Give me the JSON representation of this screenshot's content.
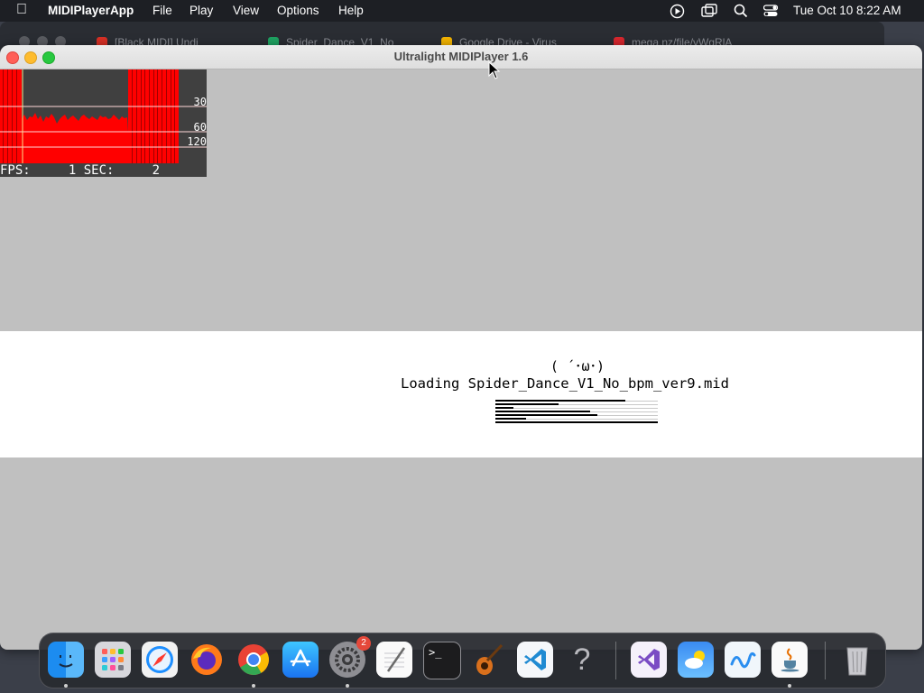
{
  "menubar": {
    "app_name": "MIDIPlayerApp",
    "menus": [
      "File",
      "Play",
      "View",
      "Options",
      "Help"
    ],
    "clock": "Tue Oct 10  8:22 AM"
  },
  "background_window": {
    "tabs": [
      {
        "label": "[Black MIDI] Undi",
        "color": "#d93025"
      },
      {
        "label": "Spider_Dance_V1_No",
        "color": "#1ea362"
      },
      {
        "label": "Google Drive - Virus",
        "color": "#f4b400"
      },
      {
        "label": "mega.nz/file/yWgRlA",
        "color": "#d9272e"
      }
    ]
  },
  "window": {
    "title": "Ultralight MIDIPlayer 1.6"
  },
  "fps_overlay": {
    "scale_labels": [
      "30",
      "60",
      "120"
    ],
    "stats_line": "FPS:     1 SEC:     2"
  },
  "loading": {
    "face": "( ´･ω･)",
    "text": "Loading Spider_Dance_V1_No_bpm_ver9.mid"
  },
  "dock": {
    "items": [
      {
        "name": "finder-icon",
        "running": true
      },
      {
        "name": "launchpad-icon",
        "running": false
      },
      {
        "name": "safari-icon",
        "running": false
      },
      {
        "name": "firefox-icon",
        "running": false
      },
      {
        "name": "chrome-icon",
        "running": true
      },
      {
        "name": "app-store-icon",
        "running": false
      },
      {
        "name": "system-settings-icon",
        "running": true,
        "badge": "2"
      },
      {
        "name": "textedit-icon",
        "running": false
      },
      {
        "name": "terminal-icon",
        "running": false
      },
      {
        "name": "garageband-icon",
        "running": false
      },
      {
        "name": "vscode-icon",
        "running": false
      },
      {
        "name": "unknown-app-icon",
        "running": false
      },
      {
        "name": "visual-studio-icon",
        "running": false
      },
      {
        "name": "weather-icon",
        "running": false
      },
      {
        "name": "freeform-icon",
        "running": false
      },
      {
        "name": "java-icon",
        "running": true
      },
      {
        "name": "trash-icon",
        "running": false
      }
    ]
  }
}
